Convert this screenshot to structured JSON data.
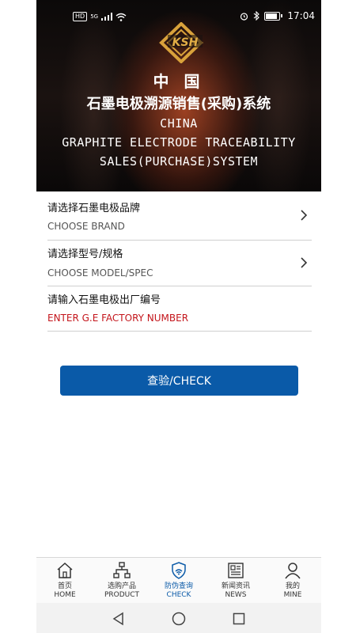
{
  "status_bar": {
    "network_badge": "HD",
    "network_type": "5G",
    "time": "17:04",
    "icons": [
      "signal-icon",
      "wifi-icon",
      "alarm-icon",
      "bluetooth-icon",
      "battery-icon"
    ]
  },
  "header": {
    "logo_text": "KSH",
    "title_cn_line1": "中 国",
    "title_cn_line2": "石墨电极溯源销售(采购)系统",
    "title_en_line1": "CHINA",
    "title_en_line2": "GRAPHITE ELECTRODE TRACEABILITY",
    "title_en_line3": "SALES(PURCHASE)SYSTEM"
  },
  "form": {
    "brand": {
      "label": "请选择石墨电极品牌",
      "placeholder": "CHOOSE BRAND"
    },
    "model": {
      "label": "请选择型号/规格",
      "placeholder": "CHOOSE MODEL/SPEC"
    },
    "factory_number": {
      "label": "请输入石墨电极出厂编号",
      "placeholder": "ENTER G.E FACTORY NUMBER"
    },
    "check_button": "查验/CHECK"
  },
  "tabs": [
    {
      "cn": "首页",
      "en": "HOME",
      "icon": "home-icon",
      "active": false
    },
    {
      "cn": "选购产品",
      "en": "PRODUCT",
      "icon": "sitemap-icon",
      "active": false
    },
    {
      "cn": "防伪查询",
      "en": "CHECK",
      "icon": "anti-counterfeit-icon",
      "active": true
    },
    {
      "cn": "新闻资讯",
      "en": "NEWS",
      "icon": "newspaper-icon",
      "active": false
    },
    {
      "cn": "我的",
      "en": "MINE",
      "icon": "user-icon",
      "active": false
    }
  ],
  "colors": {
    "accent": "#0a5aa8",
    "placeholder_red": "#c4161c"
  }
}
